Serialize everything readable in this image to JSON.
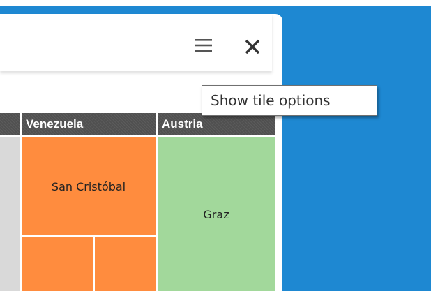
{
  "tile": {
    "menu_icon": "hamburger-menu-icon",
    "close_icon": "close-icon"
  },
  "treemap": {
    "groups": [
      {
        "label": "",
        "color": "#505050"
      },
      {
        "label": "Venezuela",
        "color": "#505050"
      },
      {
        "label": "Austria",
        "color": "#505050"
      }
    ],
    "tiles": [
      {
        "label": "",
        "color": "#d9d9d9",
        "group": ""
      },
      {
        "label": "San Cristóbal",
        "color": "#ff8c3e",
        "group": "Venezuela"
      },
      {
        "label": "",
        "color": "#ff8c3e",
        "group": "Venezuela"
      },
      {
        "label": "",
        "color": "#ff8c3e",
        "group": "Venezuela"
      },
      {
        "label": "Graz",
        "color": "#a2d89b",
        "group": "Austria"
      }
    ]
  },
  "tooltip": {
    "text": "Show tile options"
  },
  "colors": {
    "background": "#1e88d2",
    "venezuela": "#ff8c3e",
    "austria": "#a2d89b",
    "header": "#505050"
  }
}
